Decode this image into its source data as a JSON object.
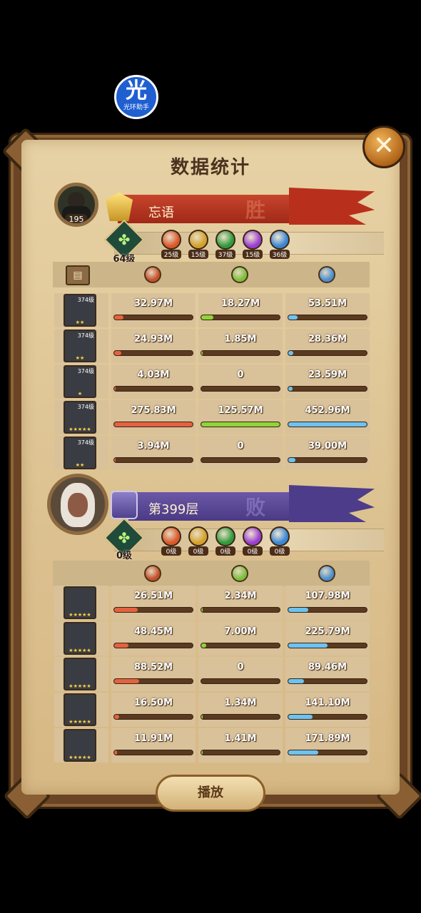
{
  "app_badge": {
    "glyph": "光",
    "label": "光环助手"
  },
  "title": "数据统计",
  "close_icon": "close-icon",
  "player": {
    "name": "忘语",
    "avatar_level": "195",
    "result": "胜",
    "tree_level": "64级",
    "buffs": [
      {
        "icon": "fire-icon",
        "level": "25级",
        "color": "#d9582a"
      },
      {
        "icon": "shield-icon",
        "level": "15级",
        "color": "#d3a12a"
      },
      {
        "icon": "leaf-icon",
        "level": "37级",
        "color": "#2f9a3c"
      },
      {
        "icon": "orb-icon",
        "level": "15级",
        "color": "#9a3ed1"
      },
      {
        "icon": "ice-icon",
        "level": "36级",
        "color": "#3a86d4"
      }
    ],
    "heroes": [
      {
        "level": "374级",
        "stars": "★★",
        "damage": "32.97M",
        "heal": "18.27M",
        "taken": "53.51M",
        "damage_fill": 0.12,
        "heal_fill": 0.15,
        "taken_fill": 0.12
      },
      {
        "level": "374级",
        "stars": "★★",
        "damage": "24.93M",
        "heal": "1.85M",
        "taken": "28.36M",
        "damage_fill": 0.09,
        "heal_fill": 0.02,
        "taken_fill": 0.06
      },
      {
        "level": "374级",
        "stars": "★",
        "damage": "4.03M",
        "heal": "0",
        "taken": "23.59M",
        "damage_fill": 0.02,
        "heal_fill": 0.0,
        "taken_fill": 0.05
      },
      {
        "level": "374级",
        "stars": "★★★★★",
        "damage": "275.83M",
        "heal": "125.57M",
        "taken": "452.96M",
        "damage_fill": 1.0,
        "heal_fill": 1.0,
        "taken_fill": 1.0
      },
      {
        "level": "374级",
        "stars": "★★",
        "damage": "3.94M",
        "heal": "0",
        "taken": "39.00M",
        "damage_fill": 0.02,
        "heal_fill": 0.0,
        "taken_fill": 0.09
      }
    ]
  },
  "enemy": {
    "name": "第399层",
    "result": "败",
    "tree_level": "0级",
    "buffs": [
      {
        "icon": "fire-icon",
        "level": "0级",
        "color": "#d9582a"
      },
      {
        "icon": "shield-icon",
        "level": "0级",
        "color": "#d3a12a"
      },
      {
        "icon": "leaf-icon",
        "level": "0级",
        "color": "#2f9a3c"
      },
      {
        "icon": "orb-icon",
        "level": "0级",
        "color": "#9a3ed1"
      },
      {
        "icon": "ice-icon",
        "level": "0级",
        "color": "#3a86d4"
      }
    ],
    "heroes": [
      {
        "stars": "★★★★★",
        "damage": "26.51M",
        "heal": "2.34M",
        "taken": "107.98M",
        "damage_fill": 0.3,
        "heal_fill": 0.02,
        "taken_fill": 0.25
      },
      {
        "stars": "★★★★★",
        "damage": "48.45M",
        "heal": "7.00M",
        "taken": "225.79M",
        "damage_fill": 0.18,
        "heal_fill": 0.06,
        "taken_fill": 0.5
      },
      {
        "stars": "★★★★★",
        "damage": "88.52M",
        "heal": "0",
        "taken": "89.46M",
        "damage_fill": 0.32,
        "heal_fill": 0.0,
        "taken_fill": 0.2
      },
      {
        "stars": "★★★★★",
        "damage": "16.50M",
        "heal": "1.34M",
        "taken": "141.10M",
        "damage_fill": 0.06,
        "heal_fill": 0.02,
        "taken_fill": 0.31
      },
      {
        "stars": "★★★★★",
        "damage": "11.91M",
        "heal": "1.41M",
        "taken": "171.89M",
        "damage_fill": 0.04,
        "heal_fill": 0.02,
        "taken_fill": 0.38
      }
    ]
  },
  "columns": [
    {
      "icon": "damage-icon",
      "color": "#c5502a"
    },
    {
      "icon": "heal-icon",
      "color": "#7cbf3a"
    },
    {
      "icon": "defense-icon",
      "color": "#4a8fd0"
    }
  ],
  "colors": {
    "damage_bar": "#e4623f",
    "heal_bar": "#8fd43a",
    "taken_bar": "#6cc3f2"
  },
  "play_button": "播放"
}
